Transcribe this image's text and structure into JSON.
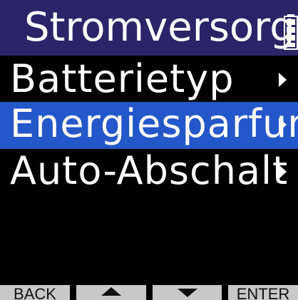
{
  "header": {
    "title": "Stromversorg.",
    "battery_icon": "battery-icon"
  },
  "menu": {
    "items": [
      {
        "label": "Batterietyp",
        "selected": false,
        "icon": "chevron-right-icon"
      },
      {
        "label": "Energiesparfun",
        "selected": true,
        "icon": "chevron-right-icon"
      },
      {
        "label": "Auto-Abschalt",
        "selected": false,
        "icon": "chevron-right-icon"
      }
    ]
  },
  "softkeys": {
    "back_label": "BACK",
    "up_icon": "arrow-up-icon",
    "down_icon": "arrow-down-icon",
    "enter_label": "ENTER"
  },
  "colors": {
    "title_bar": "#2c2468",
    "selection": "#2457c9",
    "background": "#000000",
    "softkey": "#c8c8c8",
    "text": "#ffffff"
  }
}
